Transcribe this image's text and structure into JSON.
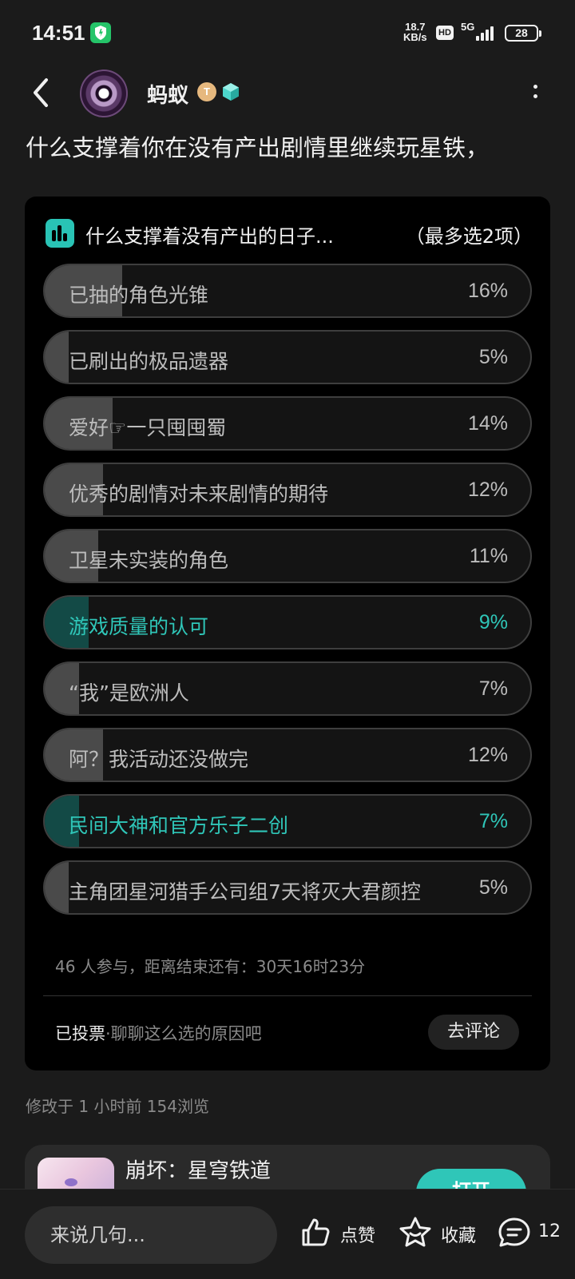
{
  "status_bar": {
    "time": "14:51",
    "net_speed_value": "18.7",
    "net_speed_unit": "KB/s",
    "hd_label": "HD",
    "network_type": "5G",
    "battery": "28"
  },
  "header": {
    "username": "蚂蚁",
    "badge_label": "T"
  },
  "post": {
    "title": "什么支撑着你在没有产出剧情里继续玩星铁，",
    "meta": "修改于 1 小时前  154浏览"
  },
  "poll": {
    "title": "什么支撑着没有产出的日子...",
    "limit": "（最多选2项）",
    "options": [
      {
        "label": "已抽的角色光锥",
        "percent_text": "16%",
        "percent": 16,
        "selected": false
      },
      {
        "label": "已刷出的极品遗器",
        "percent_text": "5%",
        "percent": 5,
        "selected": false
      },
      {
        "label": "爱好☞一只囤囤蜀",
        "percent_text": "14%",
        "percent": 14,
        "selected": false
      },
      {
        "label": "优秀的剧情对未来剧情的期待",
        "percent_text": "12%",
        "percent": 12,
        "selected": false
      },
      {
        "label": "卫星未实装的角色",
        "percent_text": "11%",
        "percent": 11,
        "selected": false
      },
      {
        "label": "游戏质量的认可",
        "percent_text": "9%",
        "percent": 9,
        "selected": true
      },
      {
        "label": "“我”是欧洲人",
        "percent_text": "7%",
        "percent": 7,
        "selected": false
      },
      {
        "label": "阿？我活动还没做完",
        "percent_text": "12%",
        "percent": 12,
        "selected": false
      },
      {
        "label": "民间大神和官方乐子二创",
        "percent_text": "7%",
        "percent": 7,
        "selected": true
      },
      {
        "label": "主角团星河猎手公司组7天将灭大君颜控",
        "percent_text": "5%",
        "percent": 5,
        "selected": false
      }
    ],
    "stats": "46 人参与，距离结束还有：30天16时23分",
    "voted_label": "已投票",
    "voted_hint": "·聊聊这么选的原因吧",
    "comment_button": "去评论"
  },
  "game_card": {
    "name": "崩坏：星穹铁道",
    "open_button": "打开"
  },
  "bottom_bar": {
    "input_placeholder": "来说几句...",
    "like_label": "点赞",
    "favorite_label": "收藏",
    "comment_count": "12"
  },
  "colors": {
    "accent": "#2fc6b8",
    "background": "#1b1b1b",
    "card": "#000000"
  },
  "icons": [
    "shield-icon",
    "signal-icon",
    "back-arrow-icon",
    "more-icon",
    "poll-chart-icon",
    "like-icon",
    "favorite-icon",
    "comment-icon"
  ]
}
